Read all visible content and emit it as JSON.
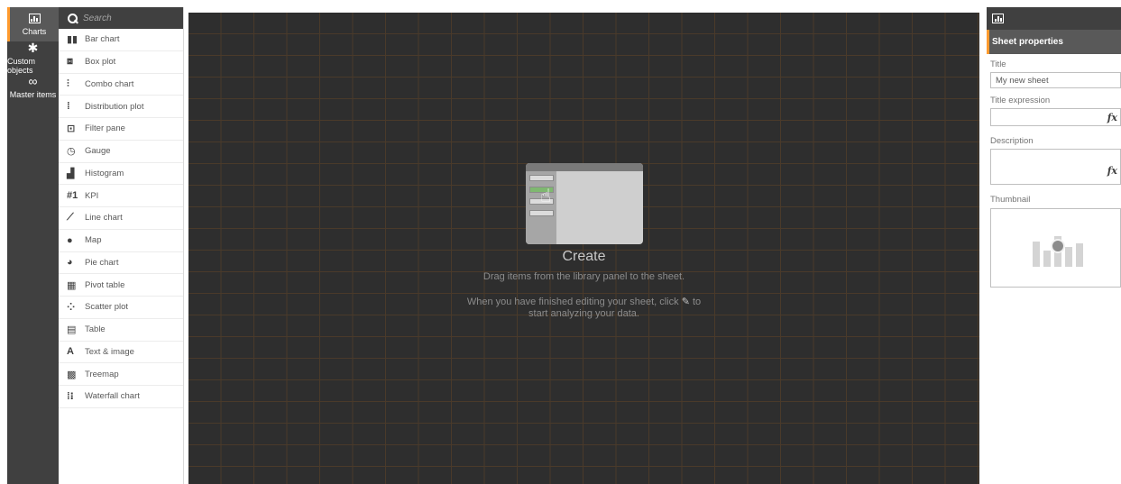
{
  "rail": {
    "charts_label": "Charts",
    "custom_label": "Custom objects",
    "master_label": "Master items",
    "accent": "#ff9a2e"
  },
  "library": {
    "search_placeholder": "Search",
    "items": [
      {
        "label": "Bar chart",
        "icon": "bar-chart-icon",
        "glyph": "▮▮"
      },
      {
        "label": "Box plot",
        "icon": "box-plot-icon",
        "glyph": "⧈"
      },
      {
        "label": "Combo chart",
        "icon": "combo-chart-icon",
        "glyph": "⫶"
      },
      {
        "label": "Distribution plot",
        "icon": "distribution-plot-icon",
        "glyph": "⁞"
      },
      {
        "label": "Filter pane",
        "icon": "filter-pane-icon",
        "glyph": "⊡"
      },
      {
        "label": "Gauge",
        "icon": "gauge-icon",
        "glyph": "◷"
      },
      {
        "label": "Histogram",
        "icon": "histogram-icon",
        "glyph": "▟"
      },
      {
        "label": "KPI",
        "icon": "kpi-icon",
        "glyph": "#1"
      },
      {
        "label": "Line chart",
        "icon": "line-chart-icon",
        "glyph": "⟋"
      },
      {
        "label": "Map",
        "icon": "map-icon",
        "glyph": "●"
      },
      {
        "label": "Pie chart",
        "icon": "pie-chart-icon",
        "glyph": "◕"
      },
      {
        "label": "Pivot table",
        "icon": "pivot-table-icon",
        "glyph": "▦"
      },
      {
        "label": "Scatter plot",
        "icon": "scatter-plot-icon",
        "glyph": "⁘"
      },
      {
        "label": "Table",
        "icon": "table-icon",
        "glyph": "▤"
      },
      {
        "label": "Text & image",
        "icon": "text-image-icon",
        "glyph": "A"
      },
      {
        "label": "Treemap",
        "icon": "treemap-icon",
        "glyph": "▩"
      },
      {
        "label": "Waterfall chart",
        "icon": "waterfall-chart-icon",
        "glyph": "⁞⁝"
      }
    ]
  },
  "canvas": {
    "title": "Create",
    "line1": "Drag items from the library panel to the sheet.",
    "line2a": "When you have finished editing your sheet, click",
    "line2b": "to",
    "line3": "start analyzing your data."
  },
  "properties": {
    "header": "Sheet properties",
    "title_label": "Title",
    "title_value": "My new sheet",
    "title_expression_label": "Title expression",
    "description_label": "Description",
    "thumbnail_label": "Thumbnail",
    "fx": "fx"
  }
}
